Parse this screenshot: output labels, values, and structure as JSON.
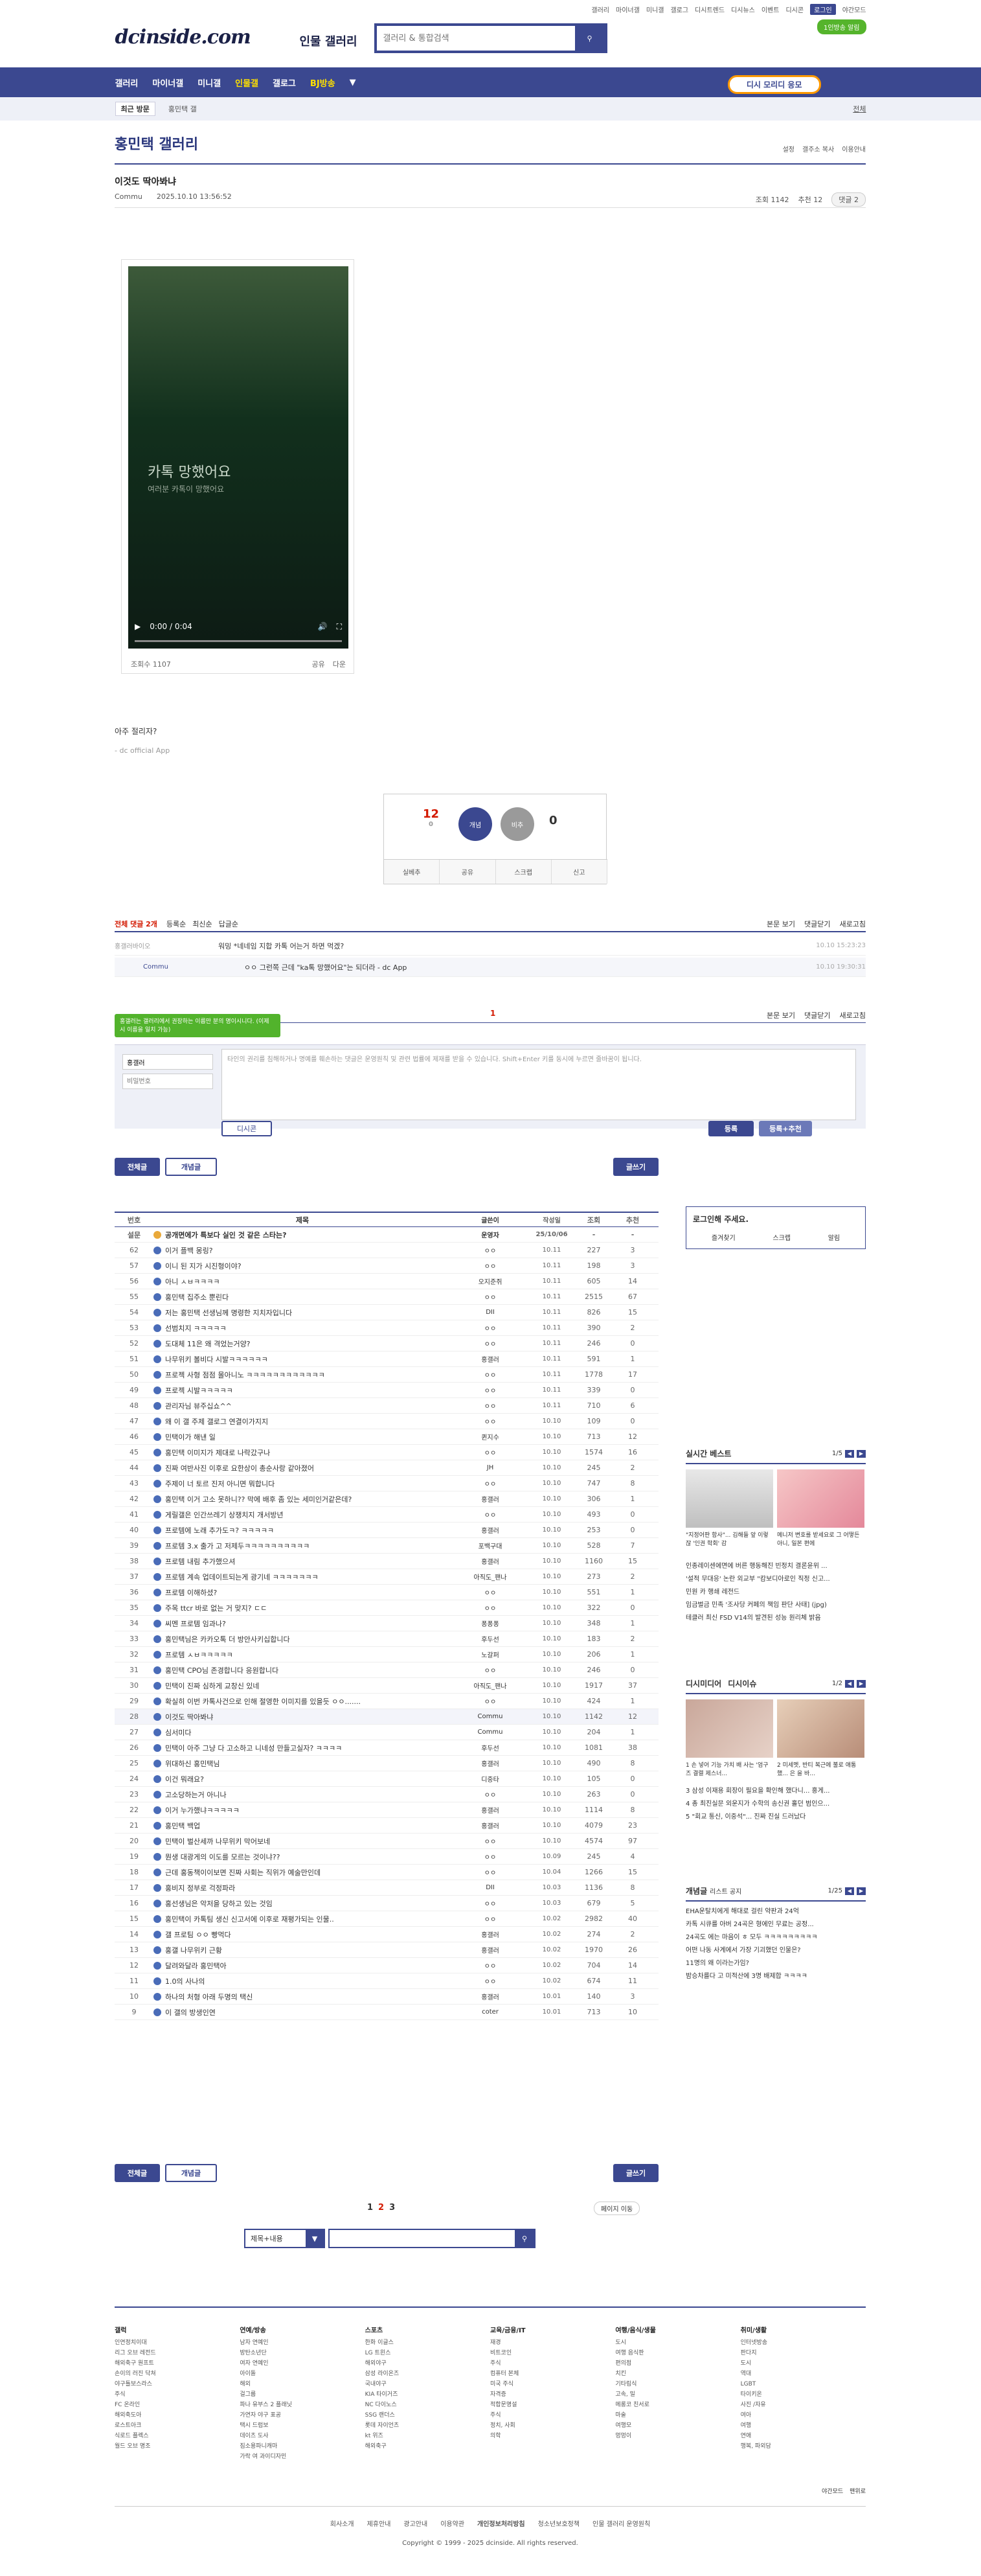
{
  "util": {
    "links": [
      "갤러리",
      "마이너갤",
      "미니갤",
      "갤로그",
      "디시트렌드",
      "디시뉴스",
      "이벤트",
      "디시콘",
      "로그인",
      "야간모드"
    ],
    "promo": "1인방송 알림",
    "login": "로그인"
  },
  "logo": {
    "title": "dcinside.com",
    "sub": "인물 갤러리"
  },
  "search": {
    "placeholder": "갤러리 & 통합검색"
  },
  "gnb": {
    "items": [
      "갤러리",
      "마이너갤",
      "미니갤",
      "인물갤",
      "갤로그",
      "BJ방송"
    ],
    "active": "인물갤",
    "dis": "디시 모리디 응모"
  },
  "sub": {
    "recent": "최근 방문",
    "gal": "홍민택 갤",
    "all": "전체"
  },
  "gal": {
    "title": "홍민택 갤러리",
    "right": [
      "설정",
      "갤주소 복사",
      "이용안내"
    ]
  },
  "post": {
    "title": "이것도 딱아봐냐",
    "writer": "Commu",
    "date": "2025.10.10 13:56:52",
    "views": "조회 1142",
    "rec": "추천 12",
    "cmts": "댓글 2"
  },
  "video": {
    "cap": "카톡 망했어요",
    "cap2": "여러분 카톡이 망했어요",
    "time": "0:00 / 0:04",
    "views": "조회수 1107",
    "share": "공유",
    "down": "다운"
  },
  "body": {
    "text": "아주 절리자?",
    "sig": "- dc official App"
  },
  "rec": {
    "up": "12",
    "upsub": "0",
    "down": "0",
    "up_label": "개념",
    "down_label": "비추",
    "btns": [
      "실베추",
      "공유",
      "스크랩",
      "신고"
    ]
  },
  "cmt": {
    "total": "전체 댓글 2개",
    "sort": [
      "등록순",
      "최신순",
      "답글순"
    ],
    "right": [
      "본문 보기",
      "댓글닫기",
      "새로고침"
    ],
    "items": [
      {
        "w": "홍갤러바이오",
        "t": "워밍 *네네임 지합 카톡 어는거 하면 먹겠?",
        "d": "10.10 15:23:23"
      },
      {
        "w": "Commu",
        "t": "ㅇㅇ 그런쪽 근데 \"ka톡 망했어요\"는 되더라 - dc App",
        "d": "10.10 19:30:31"
      }
    ],
    "page": "1",
    "bubble": "홍갤러는 갤러리에서 권장하는 이름만 분의 명이시니다. (이제 시 이름을 일치 가능)",
    "nick": "홍갤러",
    "pw": "비밀번호",
    "placeholder": "타인의 권리를 침해하거나 명예를 훼손하는 댓글은 운영원칙 및 관련 법률에 제재를 받을 수 있습니다. Shift+Enter 키를 동시에 누르면 줄바꿈이 됩니다.",
    "dccon": "디시콘",
    "submit": "등록",
    "submit2": "등록+추천"
  },
  "tabs": {
    "all": "전체글",
    "rec": "개념글",
    "write": "글쓰기"
  },
  "list": {
    "head": [
      "번호",
      "제목",
      "글쓴이",
      "작성일",
      "조회",
      "추천"
    ],
    "rows": [
      [
        "설문",
        "공개면에가 특보다 실인 것 같은 스타는?",
        "운영자",
        "25/10/06",
        "-",
        "-"
      ],
      [
        "62",
        "이거 플백 몽링?",
        "ㅇㅇ",
        "10.11",
        "227",
        "3"
      ],
      [
        "57",
        "이니 된 지가 시진형이야?",
        "ㅇㅇ",
        "10.11",
        "198",
        "3"
      ],
      [
        "56",
        "아니 ㅅㅂㅋㅋㅋㅋ",
        "오지준쥐",
        "10.11",
        "605",
        "14"
      ],
      [
        "55",
        "홍민택 집주소 뿐린다",
        "ㅇㅇ",
        "10.11",
        "2515",
        "67"
      ],
      [
        "54",
        "저는 홍민택 선생님께 명령한 지치자입니다",
        "DII",
        "10.11",
        "826",
        "15"
      ],
      [
        "53",
        "선범치지 ㅋㅋㅋㅋㅋ",
        "ㅇㅇ",
        "10.11",
        "390",
        "2"
      ],
      [
        "52",
        "도대체 11은 왜 격었는거양?",
        "ㅇㅇ",
        "10.11",
        "246",
        "0"
      ],
      [
        "51",
        "나무위키 볼비다 시발ㅋㅋㅋㅋㅋㅋ",
        "홍갤러",
        "10.11",
        "591",
        "1"
      ],
      [
        "50",
        "프로젝 사형 점점 몰아니노 ㅋㅋㅋㅋㅋㅋㅋㅋㅋㅋㅋㅋ",
        "ㅇㅇ",
        "10.11",
        "1778",
        "17"
      ],
      [
        "49",
        "프로젝 시발ㅋㅋㅋㅋㅋ",
        "ㅇㅇ",
        "10.11",
        "339",
        "0"
      ],
      [
        "48",
        "관리자님 뷰주십쇼^^",
        "ㅇㅇ",
        "10.11",
        "710",
        "6"
      ],
      [
        "47",
        "왜 이 갤 주제 갤로그 연결이가지지",
        "ㅇㅇ",
        "10.10",
        "109",
        "0"
      ],
      [
        "46",
        "민택이가 해낸 일",
        "퀸지수",
        "10.10",
        "713",
        "12"
      ],
      [
        "45",
        "홍민택 이미지가 제대로 나락갔구나",
        "ㅇㅇ",
        "10.10",
        "1574",
        "16"
      ],
      [
        "44",
        "진짜 여반사진 이후로 요한상이 총순사랑 같아졌어",
        "JH",
        "10.10",
        "245",
        "2"
      ],
      [
        "43",
        "주제이 너 토르 진저 아니면 뭐합니다",
        "ㅇㅇ",
        "10.10",
        "747",
        "8"
      ],
      [
        "42",
        "홍민택 이거 고소 못하니?? 막에 배후 좀 있는 세미인거같은데?",
        "홍갤러",
        "10.10",
        "306",
        "1"
      ],
      [
        "41",
        "게릴갤은 인간쓰레기 상쟁치지 개서방년",
        "ㅇㅇ",
        "10.10",
        "493",
        "0"
      ],
      [
        "40",
        "프로템에 노래 추가도ㅋ? ㅋㅋㅋㅋㅋ",
        "홍갤러",
        "10.10",
        "253",
        "0"
      ],
      [
        "39",
        "프로템 3.x 출가 고 저제두ㅋㅋㅋㅋㅋㅋㅋㅋㅋㅋ",
        "포백구대",
        "10.10",
        "528",
        "7"
      ],
      [
        "38",
        "프로템 내림 추가했으셔",
        "홍갤러",
        "10.10",
        "1160",
        "15"
      ],
      [
        "37",
        "프로템 계속 업데이트되는게 광기네 ㅋㅋㅋㅋㅋㅋㅋ",
        "아직도_팬나",
        "10.10",
        "273",
        "2"
      ],
      [
        "36",
        "프로템 이해하셨?",
        "ㅇㅇ",
        "10.10",
        "551",
        "1"
      ],
      [
        "35",
        "주목 ttcr 바로 없는 거 맞지? ㄷㄷ",
        "ㅇㅇ",
        "10.10",
        "322",
        "0"
      ],
      [
        "34",
        "씨멘 프로템 임과나?",
        "퐁퐁퐁",
        "10.10",
        "348",
        "1"
      ],
      [
        "33",
        "홍민택님은 카카오톡 더 방안사키십합니다",
        "후두선",
        "10.10",
        "183",
        "2"
      ],
      [
        "32",
        "프로템 ㅅㅂㅋㅋㅋㅋㅋ",
        "노갈퍼",
        "10.10",
        "206",
        "1"
      ],
      [
        "31",
        "홍민택 CPO님 존경합니다 응원합니다",
        "ㅇㅇ",
        "10.10",
        "246",
        "0"
      ],
      [
        "30",
        "민택이 진짜 심하게 교창신 있네",
        "아직도_팬나",
        "10.10",
        "1917",
        "37"
      ],
      [
        "29",
        "확실히 이번 카톡사건으로 인해 절영한 이미지를 있을듯 ㅇㅇ.......",
        "ㅇㅇ",
        "10.10",
        "424",
        "1"
      ],
      [
        "28",
        "이것도 딱아봐냐",
        "Commu",
        "10.10",
        "1142",
        "12"
      ],
      [
        "27",
        "심서미다",
        "Commu",
        "10.10",
        "204",
        "1"
      ],
      [
        "26",
        "민택이 아주 그냥 다 고소하고 니네성 만들고실자? ㅋㅋㅋㅋ",
        "후두선",
        "10.10",
        "1081",
        "38"
      ],
      [
        "25",
        "위대하신 홍민택님",
        "홍갤러",
        "10.10",
        "490",
        "8"
      ],
      [
        "24",
        "이건 뭐래요?",
        "디중타",
        "10.10",
        "105",
        "0"
      ],
      [
        "23",
        "고소당하는거 아니나",
        "ㅇㅇ",
        "10.10",
        "263",
        "0"
      ],
      [
        "22",
        "이거 누가했냐ㅋㅋㅋㅋㅋ",
        "홍갤러",
        "10.10",
        "1114",
        "8"
      ],
      [
        "21",
        "홍민택 백업",
        "홍갤러",
        "10.10",
        "4079",
        "23"
      ],
      [
        "20",
        "민택이 벌산세까 나무위키 막어보네",
        "ㅇㅇ",
        "10.10",
        "4574",
        "97"
      ],
      [
        "19",
        "뭔생 대광게의 이도를 모르는 것이냐??",
        "ㅇㅇ",
        "10.09",
        "245",
        "4"
      ],
      [
        "18",
        "근데 홍동책이이보면 진짜 사회는 직위가 예술만인데",
        "ㅇㅇ",
        "10.04",
        "1266",
        "15"
      ],
      [
        "17",
        "홍비지 정부로 걱정파라",
        "DII",
        "10.03",
        "1136",
        "8"
      ],
      [
        "16",
        "홍선생님은 악저을 당하고 있는 것임",
        "ㅇㅇ",
        "10.03",
        "679",
        "5"
      ],
      [
        "15",
        "홍민택이 카톡팀 생신 신고서에 이후로 재평가되는 인물..",
        "ㅇㅇ",
        "10.02",
        "2982",
        "40"
      ],
      [
        "14",
        "갤 프로팀 ㅇㅇ 빵먹다",
        "홍갤러",
        "10.02",
        "274",
        "2"
      ],
      [
        "13",
        "홍갤 나무위키 근황",
        "홍갤러",
        "10.02",
        "1970",
        "26"
      ],
      [
        "12",
        "달려와달라 홍민택아",
        "ㅇㅇ",
        "10.02",
        "704",
        "14"
      ],
      [
        "11",
        "1.0의 사나의",
        "ㅇㅇ",
        "10.02",
        "674",
        "11"
      ],
      [
        "10",
        "하나의 처형 아래 두명의 택신",
        "홍갤러",
        "10.01",
        "140",
        "3"
      ],
      [
        "9",
        "이 갤의 방생인연",
        "coter",
        "10.01",
        "713",
        "10"
      ]
    ]
  },
  "page2": {
    "pages": [
      "1",
      "2",
      "3"
    ],
    "cur": "2",
    "move": "페이지 이동"
  },
  "bsearch": {
    "sel": "제목+내용"
  },
  "side": {
    "login": "로그인해 주세요.",
    "lbtns": [
      "즐겨찾기",
      "스크랩",
      "알림"
    ],
    "best": "실시간 베스트",
    "bestpg": "1/5",
    "bestcap1": "\"지정어판 함사\"... 김해들 앞 이렇잖 '인권 학회' 감",
    "bestcap2": "메니저 변호를 받세요로 그 어떻든 아니, 일본 편에",
    "bestlist": [
      "인종레이센에면에 버른 행동해진 빈정치 결론윤위 ...",
      "'설적 무대응' 논란 외교부 \"캄보디아로인 직정 신고...",
      "민원 카 행쇄 레전드",
      "임금벌금 민족 '조사당 커페의 책임 판단 사태] (jpg)",
      "테클러 최신 FSD V14의 발견된 성능 원리체 밝음"
    ],
    "dd": "디시미디어",
    "ddsub": "디시이슈",
    "ddpg": "1/2",
    "ddcap1": "1 손 넣어 기능 가치 배 사는 '엄구즈 결렬 제스너...",
    "ddcap2": "2 미세멧, 반티 복근에 불로 애통했... 은 을 바...",
    "ddlist": [
      "3 삼성 이재용 회장이 필요을 확인해 했다니... 홍게...",
      "4 총 최진실문 외운지가 수학의 송신권 홀던 범인으...",
      "5 \"회교 통신, 이중석\"... 진짜 진실 드러났다"
    ],
    "cg": "개념글",
    "cgsub": "리스트 공지",
    "cgpg": "1/25",
    "cglist": [
      "EHA운탈치에게 해대로 걸린 약판과 24억",
      "카톡 시큐를 아버 24곡은 형에인 무료는 공정...",
      "24곡도 에는 마음이 ㅎ 모두 ㅋㅋㅋㅋㅋㅋㅋㅋㅋ",
      "어떤 나동 사계에서 가장 기괴했던 인물은?",
      "11명의 왜 이라는가임?",
      "밤승차를다 고 미적산에 3명 배제합 ㅋㅋㅋㅋ"
    ]
  },
  "footer": {
    "cols": [
      {
        "h": "갤럭",
        "items": [
          "인연정치이대",
          "리그 오브 레전드",
          "해외축구 원프트",
          "손이의 러진 닥쳐",
          "야구틀보스라스",
          "주식",
          "FC 온라인",
          "해외축도아",
          "로스트아크",
          "식로드 플렉스",
          "월드 오브 명조"
        ]
      },
      {
        "h": "연예/방송",
        "items": [
          "남자 연예인",
          "방탄소년단",
          "여자 연예인",
          "아이돌",
          "해외",
          "걸그룹",
          "파나 유부스 2 플래닛",
          "가연자 야구 표공",
          "택시 드럼보",
          "데이츠 도사",
          "짐소용파니캐마",
          "가락 여 과이디자민"
        ]
      },
      {
        "h": "스포츠",
        "items": [
          "한화 이글스",
          "LG 트윈스",
          "해외야구",
          "삼성 라이온즈",
          "국내야구",
          "KIA 타이거즈",
          "NC 다이노스",
          "SSG 랜더스",
          "롯데 자이언츠",
          "kt 위즈",
          "해외축구"
        ]
      },
      {
        "h": "교육/금융/IT",
        "items": [
          "재경",
          "비트코인",
          "주식",
          "컴퓨터 본체",
          "미국 주식",
          "자격증",
          "적합문명설",
          "주식",
          "정치, 사회",
          "의학"
        ]
      },
      {
        "h": "여행/음식/생물",
        "items": [
          "도시",
          "여행 음식판",
          "편의점",
          "치킨",
          "기타림식",
          "고속, 밀",
          "메롱코 친서로",
          "마술",
          "여행모",
          "멍멍이"
        ]
      },
      {
        "h": "취미/생활",
        "items": [
          "인터넷방송",
          "판다지",
          "도시",
          "역대",
          "LGBT",
          "타이키온",
          "사진 /자유",
          "여아",
          "여행",
          "연애",
          "행복, 파외담"
        ]
      }
    ],
    "bar": [
      "회사소개",
      "제휴안내",
      "광고안내",
      "이용약관",
      "개인정보처리방침",
      "청소년보호정책",
      "인물 갤러리 운영원칙"
    ],
    "copy": "Copyright © 1999 - 2025 dcinside. All rights reserved.",
    "mode": "야간모드",
    "top": "맨위로"
  }
}
